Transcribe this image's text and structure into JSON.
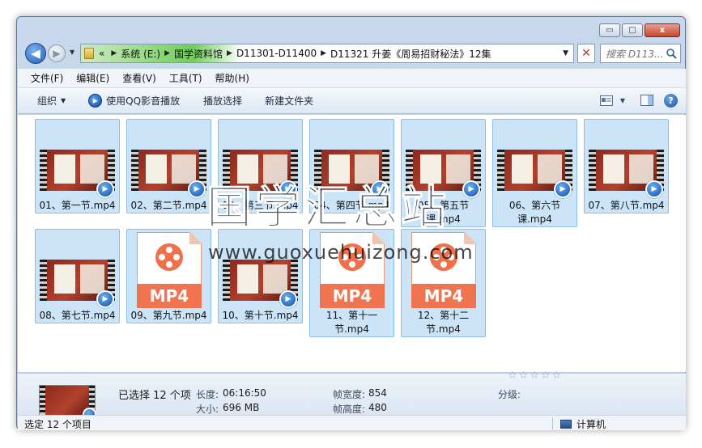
{
  "window": {
    "controls": {
      "minimize": "▭",
      "maximize": "□",
      "close": "x"
    }
  },
  "nav": {
    "back_glyph": "◀",
    "forward_glyph": "▶",
    "dropdown_glyph": "▼",
    "breadcrumb_prefix": "«",
    "crumbs": [
      "系统 (E:)",
      "国学资料馆",
      "D11301-D11400",
      "D11321 升姜《周易招财秘法》12集"
    ],
    "crumb_separator": "▶",
    "search_placeholder": "搜索 D113...",
    "clear_glyph": "✕"
  },
  "menu": [
    "文件(F)",
    "编辑(E)",
    "查看(V)",
    "工具(T)",
    "帮助(H)"
  ],
  "toolbar": {
    "organize": "组织",
    "organize_arrow": "▼",
    "play_qq": "使用QQ影音播放",
    "play_selection": "播放选择",
    "new_folder": "新建文件夹",
    "help": "?"
  },
  "files": [
    {
      "name": "01、第一节.mp4",
      "type": "video"
    },
    {
      "name": "02、第二节.mp4",
      "type": "video"
    },
    {
      "name": "03、第三节.mp4",
      "type": "video"
    },
    {
      "name": "04、第四节.mp4",
      "type": "video"
    },
    {
      "name": "05、第五节课.mp4",
      "type": "video"
    },
    {
      "name": "06、第六节课.mp4",
      "type": "video"
    },
    {
      "name": "07、第八节.mp4",
      "type": "video"
    },
    {
      "name": "08、第七节.mp4",
      "type": "video"
    },
    {
      "name": "09、第九节.mp4",
      "type": "generic",
      "badge": "MP4"
    },
    {
      "name": "10、第十节.mp4",
      "type": "video"
    },
    {
      "name": "11、第十一节.mp4",
      "type": "generic",
      "badge": "MP4"
    },
    {
      "name": "12、第十二节.mp4",
      "type": "generic",
      "badge": "MP4"
    }
  ],
  "watermark": {
    "title": "国学汇总站",
    "url": "www.guoxuehuizong.com"
  },
  "details": {
    "selected": "已选择 12 个项",
    "length_label": "长度:",
    "length": "06:16:50",
    "size_label": "大小:",
    "size": "696 MB",
    "frame_width_label": "帧宽度:",
    "frame_width": "854",
    "frame_height_label": "帧高度:",
    "frame_height": "480",
    "rating_label": "分级:",
    "stars": "☆☆☆☆☆"
  },
  "status": {
    "left": "选定 12 个项目",
    "right": "计算机"
  }
}
